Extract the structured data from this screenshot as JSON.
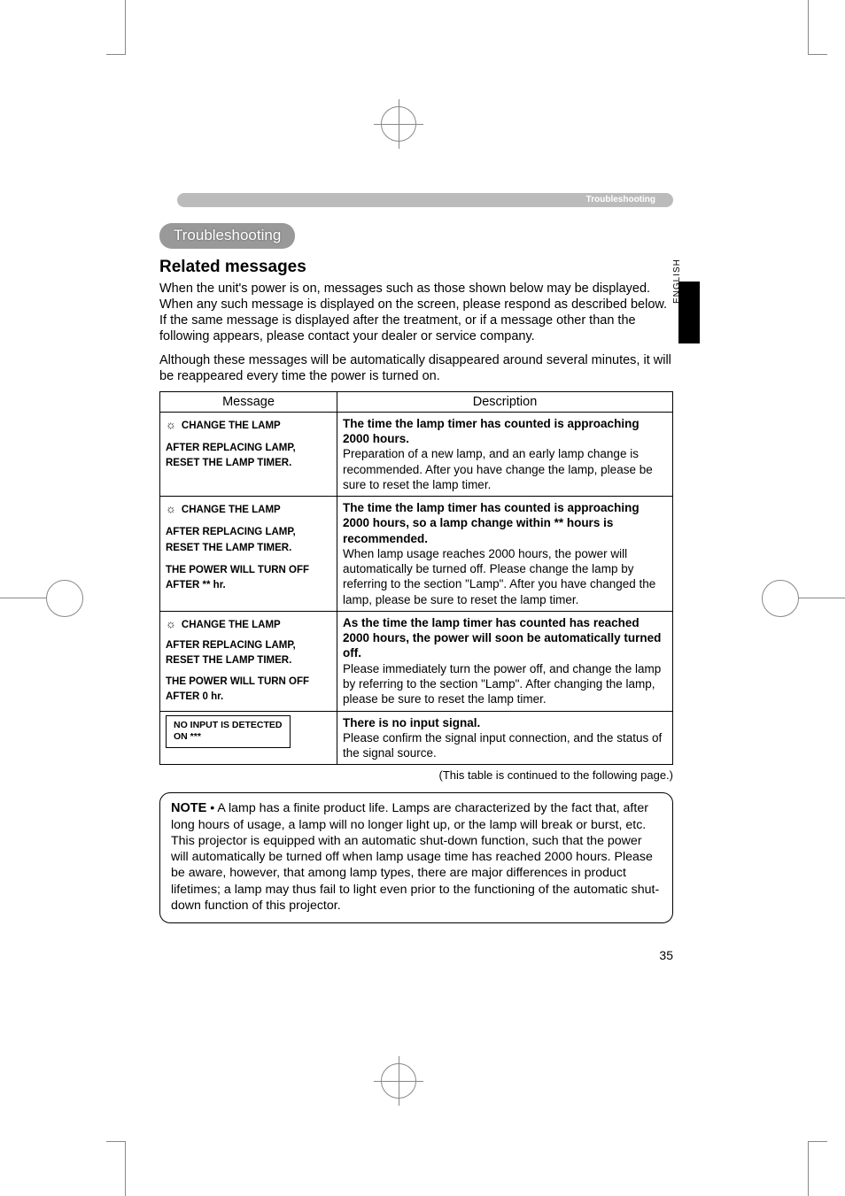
{
  "header": {
    "breadcrumb": "Troubleshooting",
    "side_tab": "ENGLISH",
    "pill_title": "Troubleshooting"
  },
  "section": {
    "heading": "Related messages",
    "intro1": "When the unit's power is on, messages such as those shown below may be displayed. When any such message is displayed on the screen, please respond as described below. If the same message is displayed after the treatment, or if a message other than the following appears, please contact your dealer or service company.",
    "intro2": "Although these messages will be automatically disappeared around several minutes, it will be reappeared every time the power is turned on."
  },
  "table": {
    "col1": "Message",
    "col2": "Description",
    "rows": [
      {
        "msg_line1": "CHANGE THE LAMP",
        "msg_line2": "AFTER REPLACING LAMP, RESET THE LAMP TIMER.",
        "msg_line3": "",
        "desc_bold": "The time the lamp timer has counted is approaching 2000 hours.",
        "desc_rest": "Preparation of a new lamp, and an early lamp change is recommended. After you have change the lamp, please be sure to reset the lamp timer."
      },
      {
        "msg_line1": "CHANGE THE LAMP",
        "msg_line2": "AFTER REPLACING LAMP, RESET THE LAMP TIMER.",
        "msg_line3": "THE POWER WILL TURN OFF AFTER ** hr.",
        "desc_bold": "The time the lamp timer has counted is approaching 2000 hours, so a lamp change within ** hours is recommended.",
        "desc_rest": "When lamp usage reaches 2000 hours, the power will automatically be turned off. Please change the lamp by referring to the section \"Lamp\". After you have changed the lamp, please be sure to reset the lamp timer."
      },
      {
        "msg_line1": "CHANGE THE LAMP",
        "msg_line2": "AFTER REPLACING LAMP, RESET THE LAMP TIMER.",
        "msg_line3": "THE POWER WILL TURN OFF AFTER 0 hr.",
        "desc_bold": "As the time the lamp timer has counted has reached 2000 hours, the power will soon be automatically turned off.",
        "desc_rest": "Please immediately turn the power off, and change the lamp by referring to the section \"Lamp\". After changing the lamp, please be sure to reset the lamp timer."
      },
      {
        "msg_box_line1": "NO INPUT IS DETECTED",
        "msg_box_line2": "ON ***",
        "desc_bold": "There is no input signal.",
        "desc_rest": "Please confirm the signal input connection, and the status of the signal source."
      }
    ],
    "continued_note": "(This table is continued to the following page.)"
  },
  "note": {
    "label": "NOTE",
    "text": "• A lamp has a finite product life. Lamps are characterized by the fact that, after long hours of usage, a lamp will no longer light up, or the lamp will break or burst, etc. This projector is equipped with an automatic shut-down function, such that the power will automatically be turned off when lamp usage time has reached 2000 hours. Please be aware, however, that among lamp types, there are major differences in product lifetimes; a lamp may thus fail to light even prior to the functioning of the automatic shut-down function of this projector."
  },
  "page_number": "35",
  "icons": {
    "sun": "☼"
  }
}
